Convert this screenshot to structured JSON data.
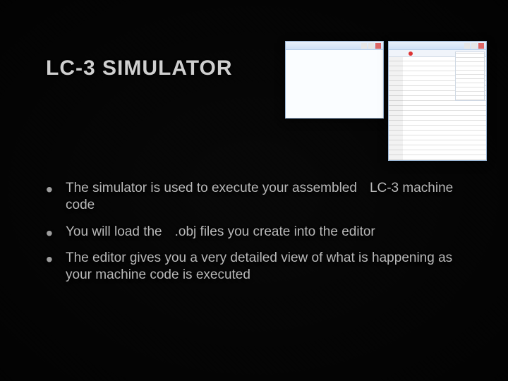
{
  "title": "LC-3 SIMULATOR",
  "bullets": {
    "b1a": "The simulator is used to execute your assembled",
    "b1b": "LC-3 machine code",
    "b2a": "You will load the",
    "b2b": ".obj",
    "b2c": "files you create into the editor",
    "b3": "The editor gives you a very detailed view of what is happening as your machine code is executed"
  }
}
